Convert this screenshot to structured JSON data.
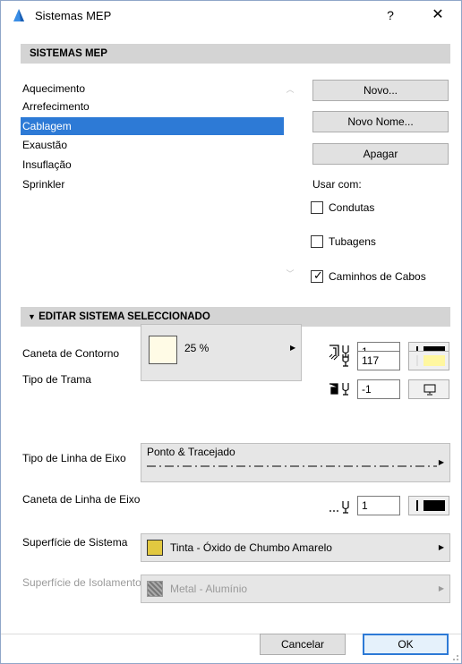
{
  "window": {
    "title": "Sistemas MEP",
    "help_glyph": "?",
    "close_glyph": "✕"
  },
  "systems_section": {
    "header": "SISTEMAS MEP",
    "items": [
      {
        "label": "Aquecimento",
        "selected": false
      },
      {
        "label": "Arrefecimento",
        "selected": false
      },
      {
        "label": "Cablagem",
        "selected": true
      },
      {
        "label": "Exaustão",
        "selected": false
      },
      {
        "label": "Insuflação",
        "selected": false
      },
      {
        "label": "Sprinkler",
        "selected": false
      }
    ],
    "buttons": {
      "new": "Novo...",
      "rename": "Novo Nome...",
      "delete": "Apagar"
    },
    "use_with_label": "Usar com:",
    "use_with": [
      {
        "label": "Condutas",
        "checked": false
      },
      {
        "label": "Tubagens",
        "checked": false
      },
      {
        "label": "Caminhos de Cabos",
        "checked": true
      }
    ]
  },
  "edit_section": {
    "header": "EDITAR SISTEMA SELECCIONADO",
    "contour_pen": {
      "label": "Caneta de Contorno",
      "value": "1",
      "color": "#000000"
    },
    "fill_type": {
      "label": "Tipo de Trama",
      "pattern_percent": "25 %",
      "pattern_color": "#fffbe6",
      "fg_pen_value": "117",
      "fg_pen_color": "#fff7a0",
      "bg_pen_value": "-1"
    },
    "axis_line_type": {
      "label": "Tipo de Linha de Eixo",
      "value": "Ponto & Tracejado"
    },
    "axis_line_pen": {
      "label": "Caneta de Linha de Eixo",
      "value": "1",
      "color": "#000000"
    },
    "system_surface": {
      "label": "Superfície de Sistema",
      "value": "Tinta - Óxido de Chumbo Amarelo",
      "swatch_color": "#e2c840"
    },
    "insulation_surface": {
      "label": "Superfície de Isolamento",
      "value": "Metal - Alumínio",
      "enabled": false
    }
  },
  "footer": {
    "cancel": "Cancelar",
    "ok": "OK"
  },
  "colors": {
    "selection": "#2d7ad6",
    "header_bg": "#d4d4d4"
  }
}
